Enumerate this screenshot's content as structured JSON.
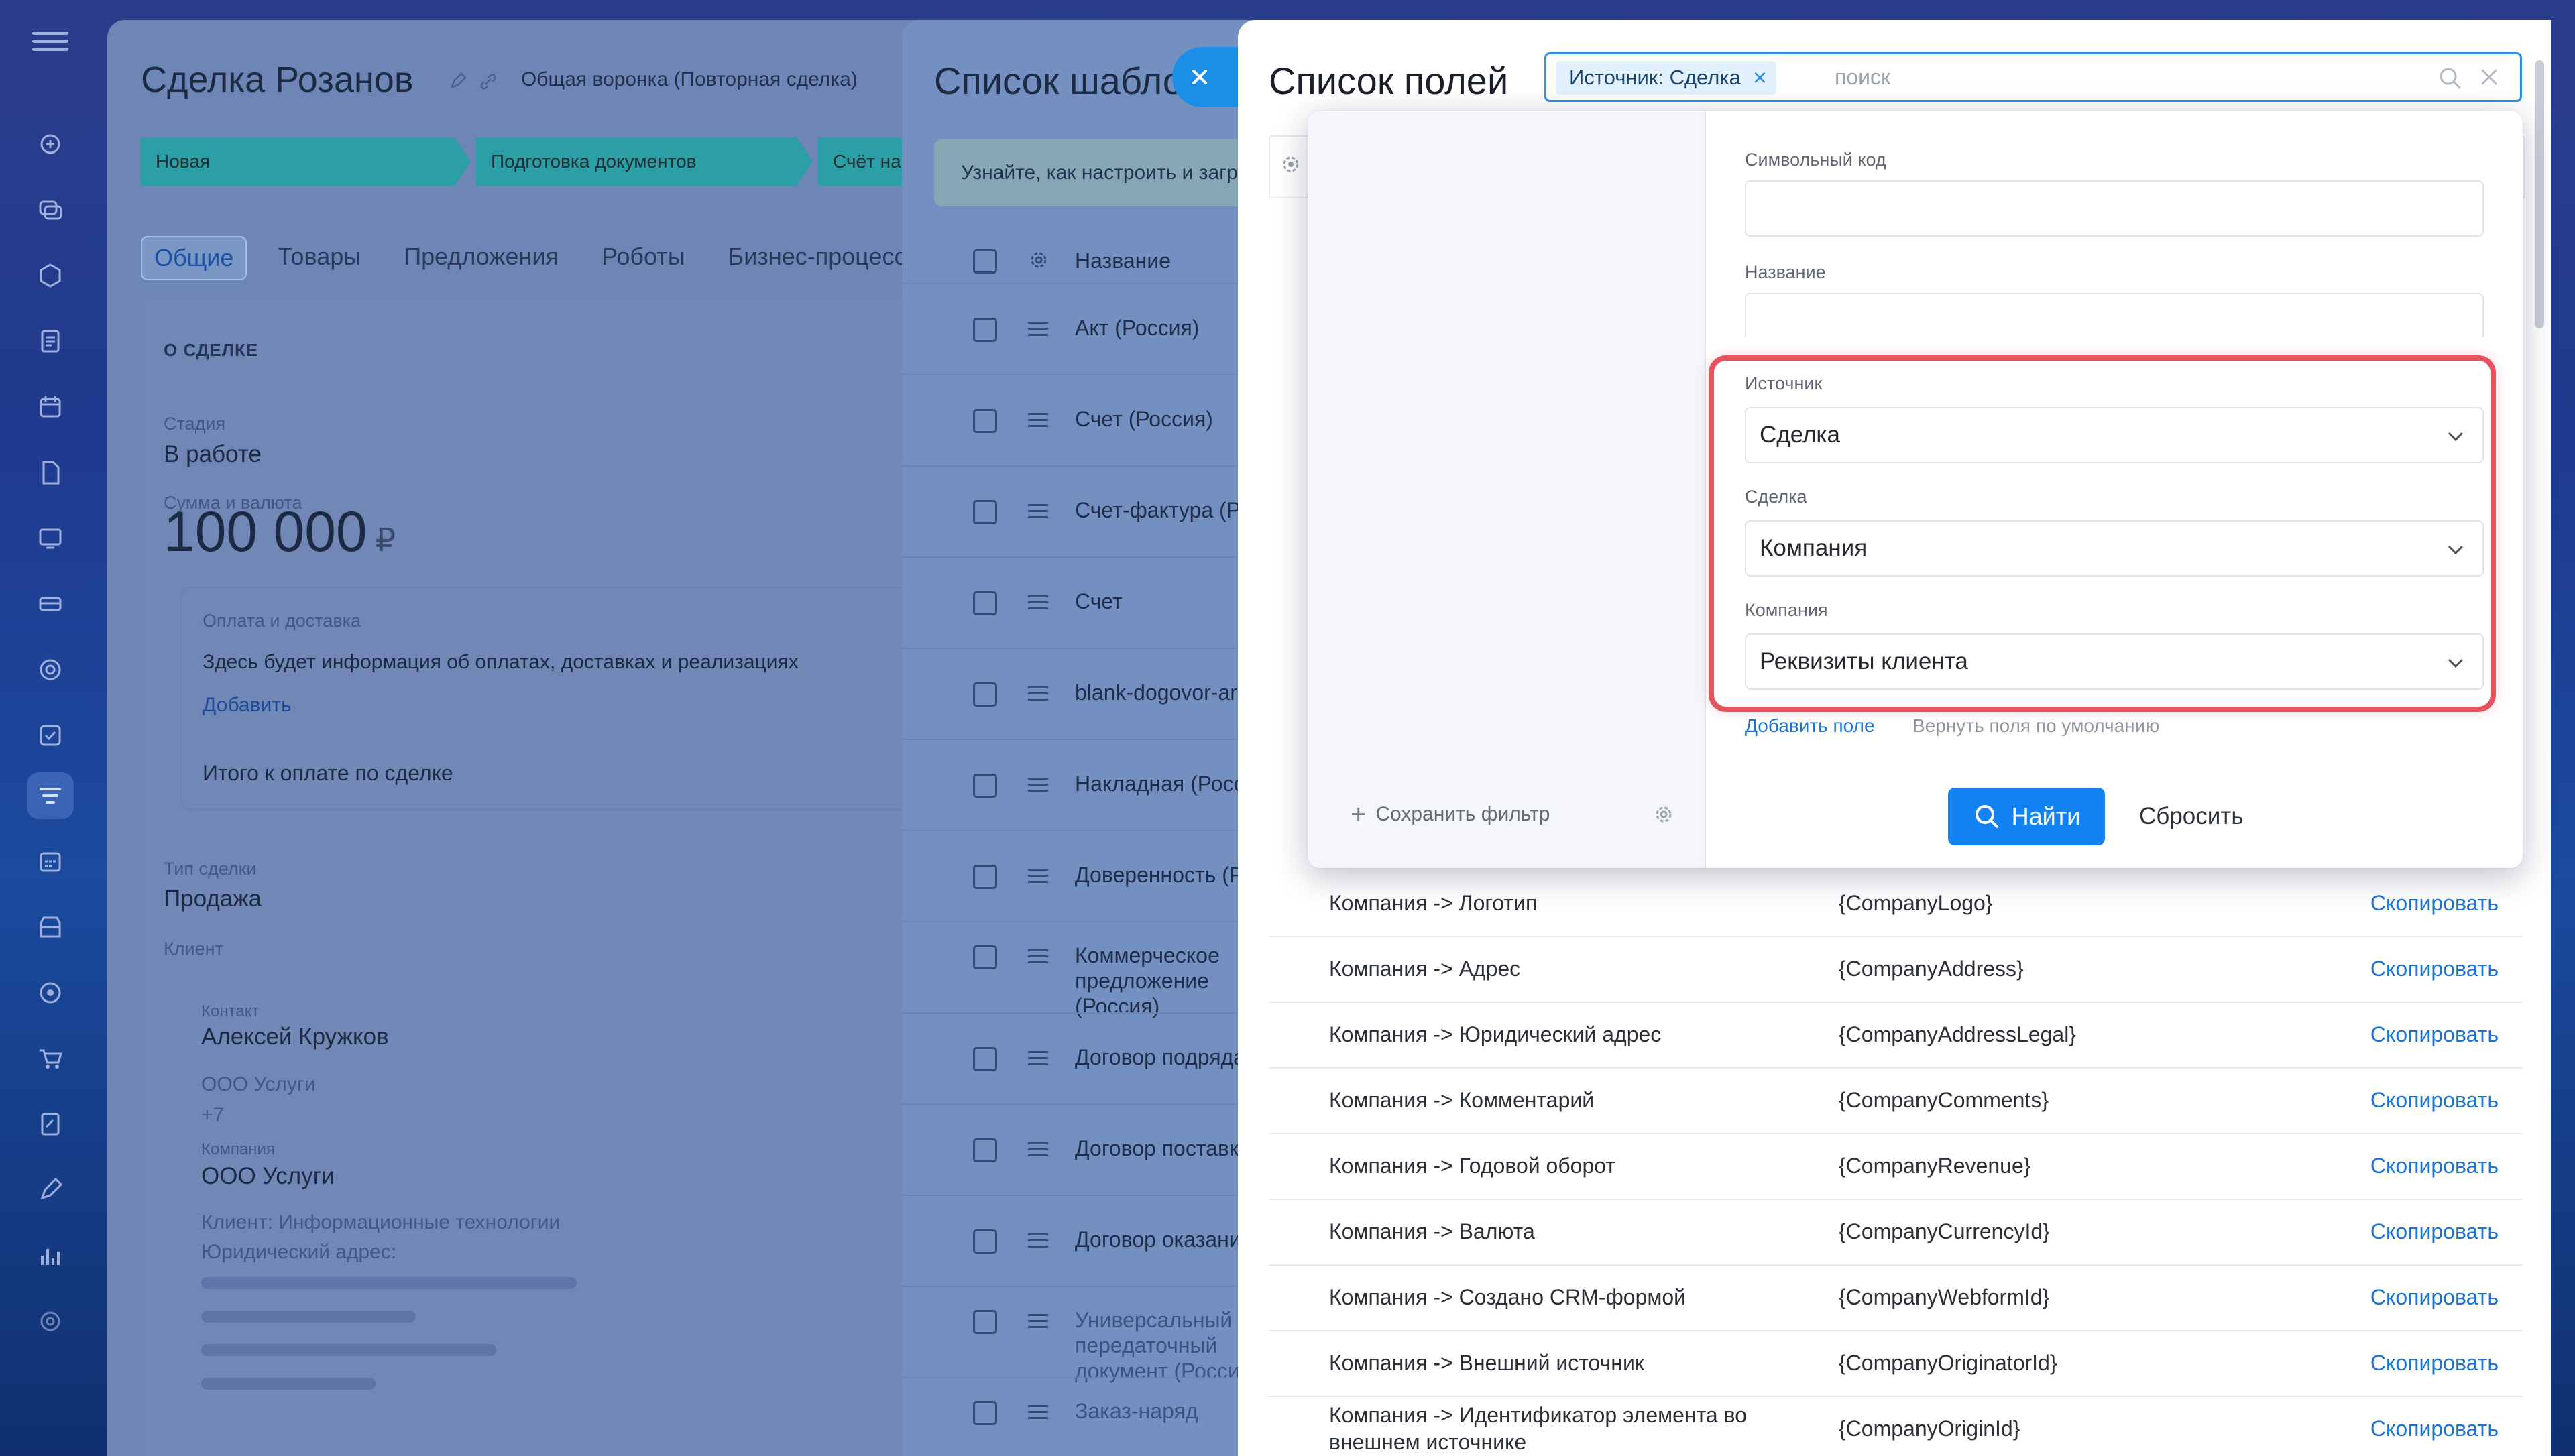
{
  "deal": {
    "title": "Сделка Розанов",
    "funnel": "Общая воронка (Повторная сделка)",
    "stages": [
      "Новая",
      "Подготовка документов",
      "Счёт на"
    ],
    "tabs": [
      "Общие",
      "Товары",
      "Предложения",
      "Роботы",
      "Бизнес-процессы"
    ],
    "section_title": "О СДЕЛКЕ",
    "stage_label": "Стадия",
    "stage_value": "В работе",
    "sum_label": "Сумма и валюта",
    "sum_value": "100 000",
    "currency": "₽",
    "payment_title": "Оплата и доставка",
    "payment_text": "Здесь будет информация об оплатах, доставках и реализациях",
    "payment_add": "Добавить",
    "total_label": "Итого к оплате по сделке",
    "type_label": "Тип сделки",
    "type_value": "Продажа",
    "client_label": "Клиент",
    "contact_label": "Контакт",
    "contact_name": "Алексей Кружков",
    "contact_company": "ООО Услуги",
    "contact_phone": "+7",
    "company_label": "Компания",
    "company_name": "ООО Услуги",
    "company_info": "Клиент: Информационные технологии",
    "company_address": "Юридический адрес:"
  },
  "templates": {
    "title": "Список шаблонов",
    "info": "Узнайте, как настроить и загрузить шаблоны",
    "column_name": "Название",
    "rows": [
      "Акт (Россия)",
      "Счет (Россия)",
      "Счет-фактура (Россия)",
      "Счет",
      "blank-dogovor-arendy",
      "Накладная (Россия)",
      "Доверенность (Россия)",
      "Коммерческое предложение (Россия)",
      "Договор подряда",
      "Договор поставки",
      "Договор оказания услуг",
      "Универсальный передаточный документ (Россия)",
      "Заказ-наряд"
    ]
  },
  "fields": {
    "title": "Список полей",
    "search_chip": "Источник: Сделка",
    "search_placeholder": "поиск",
    "rows": [
      {
        "name": "Компания -> Логотип",
        "code": "{CompanyLogo}",
        "action": "Скопировать"
      },
      {
        "name": "Компания -> Адрес",
        "code": "{CompanyAddress}",
        "action": "Скопировать"
      },
      {
        "name": "Компания -> Юридический адрес",
        "code": "{CompanyAddressLegal}",
        "action": "Скопировать"
      },
      {
        "name": "Компания -> Комментарий",
        "code": "{CompanyComments}",
        "action": "Скопировать"
      },
      {
        "name": "Компания -> Годовой оборот",
        "code": "{CompanyRevenue}",
        "action": "Скопировать"
      },
      {
        "name": "Компания -> Валюта",
        "code": "{CompanyCurrencyId}",
        "action": "Скопировать"
      },
      {
        "name": "Компания -> Создано CRM-формой",
        "code": "{CompanyWebformId}",
        "action": "Скопировать"
      },
      {
        "name": "Компания -> Внешний источник",
        "code": "{CompanyOriginatorId}",
        "action": "Скопировать"
      },
      {
        "name": "Компания -> Идентификатор элемента во внешнем источнике",
        "code": "{CompanyOriginId}",
        "action": "Скопировать"
      }
    ]
  },
  "filter": {
    "save_filter": "Сохранить фильтр",
    "symbol_code_label": "Символьный код",
    "symbol_code_value": "",
    "name_label": "Название",
    "name_value": "",
    "source_label": "Источник",
    "source_value": "Сделка",
    "deal_label": "Сделка",
    "deal_value": "Компания",
    "company_label": "Компания",
    "company_value": "Реквизиты клиента",
    "add_field": "Добавить поле",
    "reset_fields": "Вернуть поля по умолчанию",
    "find_button": "Найти",
    "reset_button": "Сбросить"
  },
  "colors": {
    "accent": "#1382f2",
    "link": "#1a74d8",
    "highlight": "#e3545f",
    "stage": "#2c9ea5"
  }
}
